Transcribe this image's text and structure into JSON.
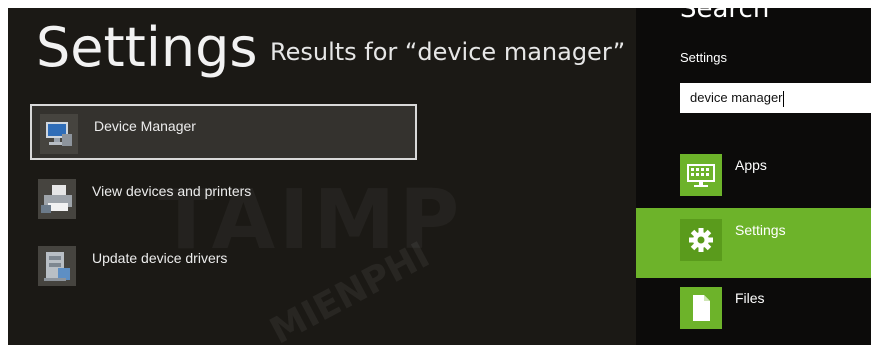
{
  "page": {
    "title": "Settings",
    "results_heading": "Results for “device manager”"
  },
  "results": [
    {
      "label": "Device Manager",
      "icon": "device-manager-icon",
      "selected": true
    },
    {
      "label": "View devices and printers",
      "icon": "devices-printers-icon",
      "selected": false
    },
    {
      "label": "Update device drivers",
      "icon": "update-drivers-icon",
      "selected": false
    }
  ],
  "search_pane": {
    "heading": "Search",
    "scope": "Settings",
    "query": "device manager",
    "categories": [
      {
        "label": "Apps",
        "icon": "keyboard-icon",
        "selected": false
      },
      {
        "label": "Settings",
        "icon": "gear-icon",
        "selected": true
      },
      {
        "label": "Files",
        "icon": "document-icon",
        "selected": false
      }
    ]
  },
  "colors": {
    "background": "#1b1915",
    "pane": "#0c0b0a",
    "accent": "#6db32a",
    "selection_border": "#d9d9d9"
  }
}
